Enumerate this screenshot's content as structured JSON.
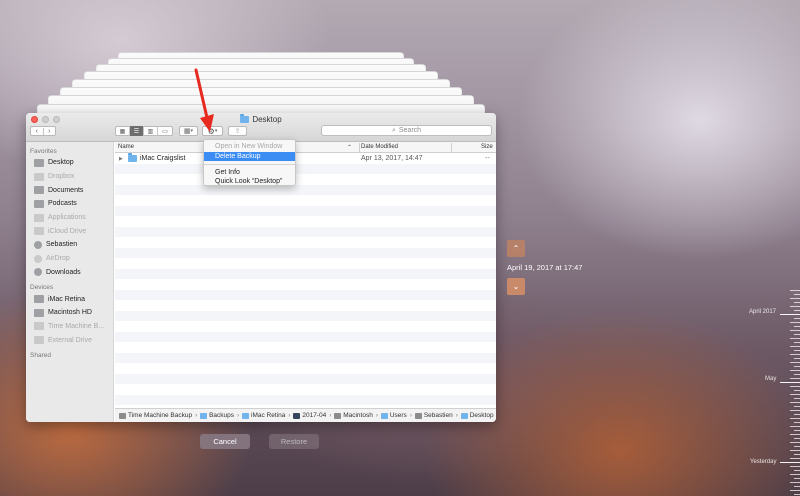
{
  "window": {
    "title": "Desktop"
  },
  "toolbar": {
    "back_icon": "chevron-left-icon",
    "forward_icon": "chevron-right-icon",
    "view_modes": [
      "icon-view-icon",
      "list-view-icon",
      "column-view-icon",
      "cover-flow-icon"
    ],
    "active_view": "list-view-icon",
    "search_placeholder": "Search"
  },
  "sidebar": {
    "favorites_heading": "Favorites",
    "favorites": [
      {
        "label": "Desktop",
        "dim": false,
        "icon": "desktop-icon"
      },
      {
        "label": "Dropbox",
        "dim": true,
        "icon": "dropbox-icon"
      },
      {
        "label": "Documents",
        "dim": false,
        "icon": "documents-icon"
      },
      {
        "label": "Podcasts",
        "dim": false,
        "icon": "folder-icon"
      },
      {
        "label": "Applications",
        "dim": true,
        "icon": "applications-icon"
      },
      {
        "label": "iCloud Drive",
        "dim": true,
        "icon": "icloud-icon"
      },
      {
        "label": "Sebastien",
        "dim": false,
        "icon": "home-icon"
      },
      {
        "label": "AirDrop",
        "dim": true,
        "icon": "airdrop-icon"
      },
      {
        "label": "Downloads",
        "dim": false,
        "icon": "downloads-icon"
      }
    ],
    "devices_heading": "Devices",
    "devices": [
      {
        "label": "iMac Retina",
        "dim": false,
        "icon": "imac-icon"
      },
      {
        "label": "Macintosh HD",
        "dim": false,
        "icon": "hard-drive-icon"
      },
      {
        "label": "Time Machine B...",
        "dim": true,
        "icon": "time-machine-drive-icon"
      },
      {
        "label": "External Drive",
        "dim": true,
        "icon": "external-drive-icon"
      }
    ],
    "shared_heading": "Shared"
  },
  "file_list": {
    "columns": {
      "name": "Name",
      "date": "Date Modified",
      "size": "Size"
    },
    "rows": [
      {
        "name": "iMac Craigslist",
        "date": "Apr 13, 2017, 14:47",
        "size": "--"
      }
    ]
  },
  "context_menu": {
    "items": [
      {
        "label": "Open in New Window",
        "state": "disabled"
      },
      {
        "label": "Delete Backup",
        "state": "selected"
      },
      {
        "label": "Get Info",
        "state": "normal"
      },
      {
        "label": "Quick Look “Desktop”",
        "state": "normal"
      }
    ]
  },
  "path_bar": [
    {
      "label": "Time Machine Backup",
      "icon": "time-machine-drive-icon"
    },
    {
      "label": "Backups",
      "icon": "folder-icon"
    },
    {
      "label": "iMac Retina",
      "icon": "folder-icon"
    },
    {
      "label": "2017-04",
      "icon": "screen-icon"
    },
    {
      "label": "Macintosh",
      "icon": "hard-drive-icon"
    },
    {
      "label": "Users",
      "icon": "folder-icon"
    },
    {
      "label": "Sebastien",
      "icon": "home-icon"
    },
    {
      "label": "Desktop",
      "icon": "folder-icon"
    }
  ],
  "buttons": {
    "cancel": "Cancel",
    "restore": "Restore"
  },
  "time_machine": {
    "current_date": "April 19, 2017 at 17:47",
    "timeline_labels": [
      "April 2017",
      "May",
      "Yesterday"
    ]
  },
  "colors": {
    "accent": "#3b8cf3",
    "annotation_arrow": "#e8291f"
  }
}
